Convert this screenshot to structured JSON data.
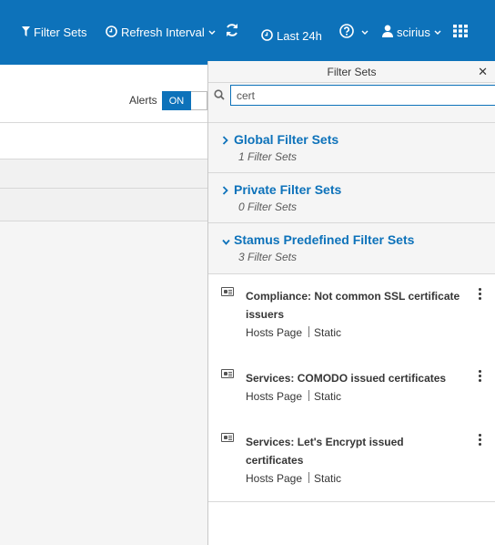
{
  "navbar": {
    "filter_sets": "Filter Sets",
    "refresh_interval": "Refresh Interval",
    "last": "Last 24h",
    "user": "scirius"
  },
  "background": {
    "alerts_label": "Alerts",
    "toggle_on": "ON"
  },
  "drawer": {
    "title": "Filter Sets",
    "search_value": "cert",
    "groups": [
      {
        "title": "Global Filter Sets",
        "count": "1 Filter Sets"
      },
      {
        "title": "Private Filter Sets",
        "count": "0 Filter Sets"
      },
      {
        "title": "Stamus Predefined Filter Sets",
        "count": "3 Filter Sets"
      }
    ],
    "items": [
      {
        "title": "Compliance: Not common SSL certificate issuers",
        "page": "Hosts Page",
        "kind": "Static"
      },
      {
        "title": "Services: COMODO issued certificates",
        "page": "Hosts Page",
        "kind": "Static"
      },
      {
        "title": "Services: Let's Encrypt issued certificates",
        "page": "Hosts Page",
        "kind": "Static"
      }
    ]
  },
  "colors": {
    "brand": "#0d72ba"
  }
}
